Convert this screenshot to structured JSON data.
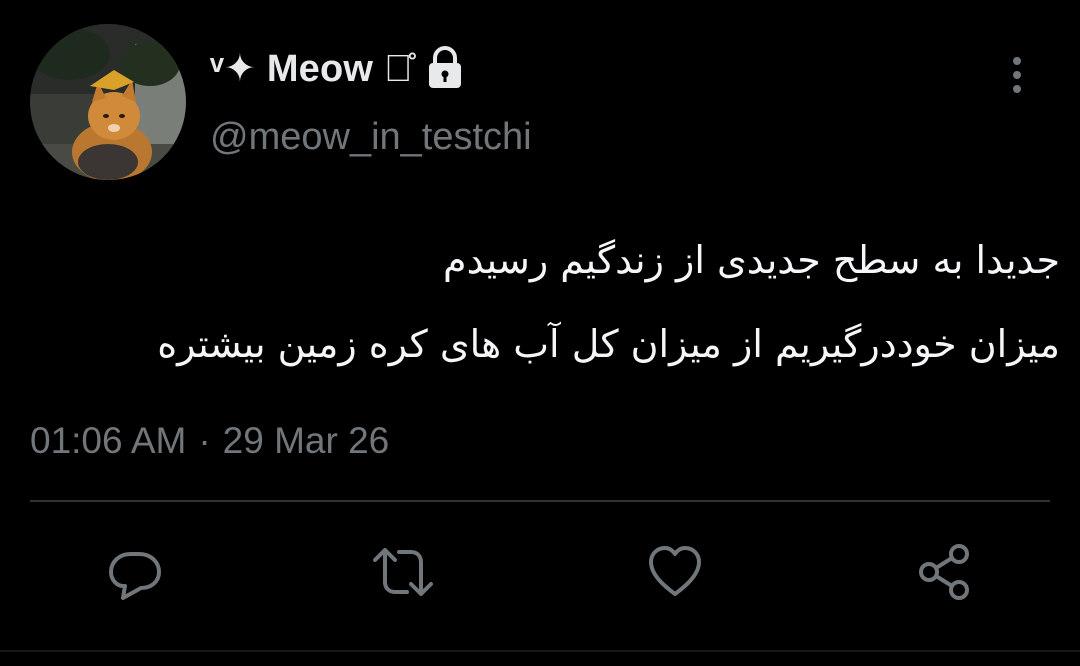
{
  "author": {
    "display_name": "ᵛ✦ Meow ฉ̊",
    "handle": "@meow_in_testchi",
    "protected": true
  },
  "tweet": {
    "lines": [
      "جدیدا به سطح جدیدی از زندگیم رسیدم",
      "میزان خوددرگیریم از میزان کل آب های کره زمین بیشتره"
    ],
    "time": "01:06 AM",
    "separator": "·",
    "date": "29 Mar 26"
  },
  "actions": [
    "reply",
    "retweet",
    "like",
    "share"
  ],
  "icons": {
    "more": "more-vertical-icon",
    "lock": "lock-icon",
    "reply": "reply-icon",
    "retweet": "retweet-icon",
    "like": "heart-icon",
    "share": "share-icon"
  },
  "colors": {
    "background": "#000000",
    "text": "#e7e9ea",
    "secondary": "#71767b",
    "divider": "#2f3336"
  }
}
